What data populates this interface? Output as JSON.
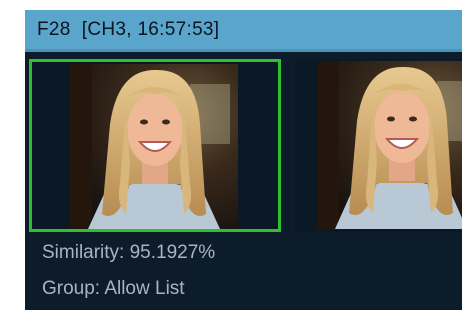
{
  "header": {
    "title": "F28  [CH3, 16:57:53]"
  },
  "thumbnails": [
    {
      "state": "selected",
      "subject": "portrait-photo"
    },
    {
      "state": "unselected",
      "subject": "portrait-photo"
    }
  ],
  "info": {
    "similarity": "Similarity: 95.1927%",
    "group": "Group: Allow List"
  },
  "colors": {
    "panel_bg": "#0d1c2b",
    "header_bg": "#5aa5cb",
    "selection_border": "#2fbf2f",
    "info_text": "#aab4bf"
  }
}
